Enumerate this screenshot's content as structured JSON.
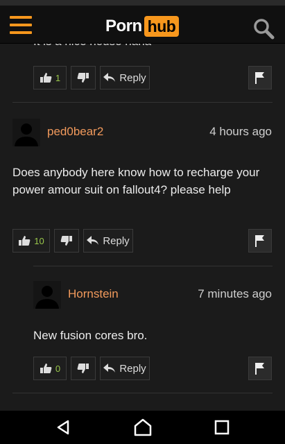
{
  "header": {
    "logo_left": "Porn",
    "logo_right": "hub"
  },
  "partial_comment": {
    "text": "It is a nice house haha",
    "likes": "1",
    "reply_label": "Reply"
  },
  "comments": [
    {
      "username": "ped0bear2",
      "time": "4 hours ago",
      "text": "Does anybody here know how to recharge your power amour suit on fallout4? please help",
      "likes": "10",
      "reply_label": "Reply"
    },
    {
      "username": "Hornstein",
      "time": "7 minutes ago",
      "text": "New fusion cores bro.",
      "likes": "0",
      "reply_label": "Reply"
    }
  ],
  "colors": {
    "accent": "#f7971d",
    "username": "#f29a5c",
    "like_count": "#9ac84b"
  }
}
